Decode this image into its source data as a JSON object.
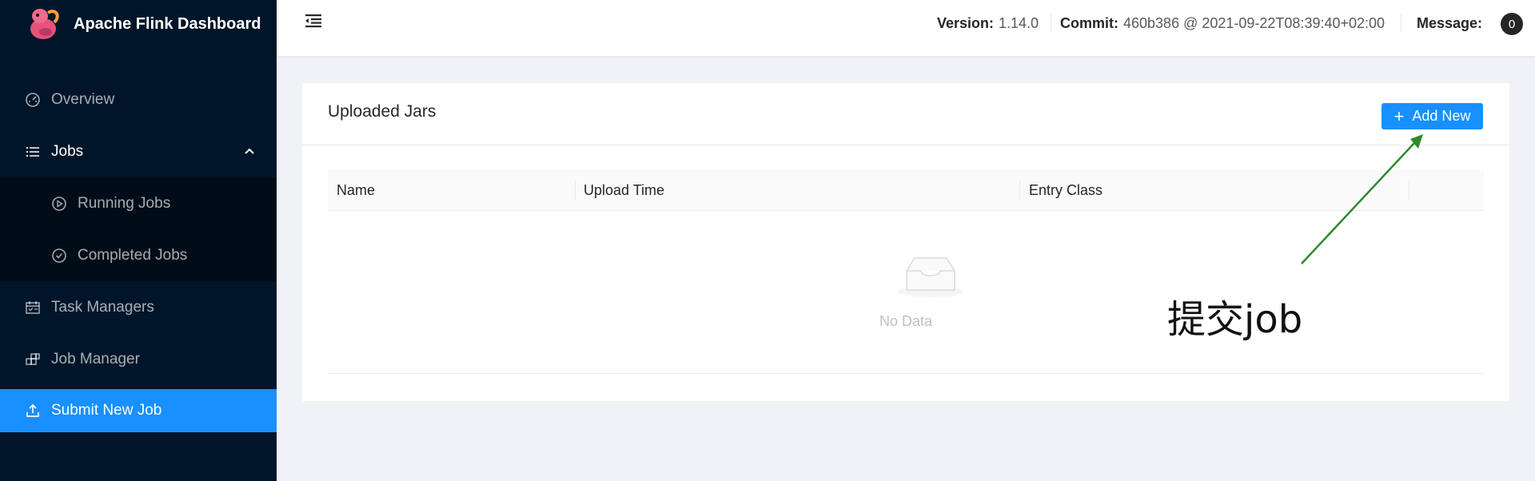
{
  "brand": {
    "title": "Apache Flink Dashboard",
    "logo_icon": "flink-squirrel-logo"
  },
  "sidebar": {
    "items": [
      {
        "label": "Overview",
        "icon": "dashboard-icon"
      },
      {
        "label": "Jobs",
        "icon": "list-icon"
      },
      {
        "label": "Running Jobs",
        "icon": "play-circle-icon"
      },
      {
        "label": "Completed Jobs",
        "icon": "check-circle-icon"
      },
      {
        "label": "Task Managers",
        "icon": "schedule-icon"
      },
      {
        "label": "Job Manager",
        "icon": "build-icon"
      },
      {
        "label": "Submit New Job",
        "icon": "upload-icon"
      }
    ]
  },
  "header": {
    "version_label": "Version:",
    "version_value": "1.14.0",
    "commit_label": "Commit:",
    "commit_value": "460b386 @ 2021-09-22T08:39:40+02:00",
    "message_label": "Message:",
    "message_count": "0"
  },
  "card": {
    "title": "Uploaded Jars",
    "add_button": "Add New",
    "columns": [
      "Name",
      "Upload Time",
      "Entry Class"
    ],
    "empty_text": "No Data"
  },
  "annotation": {
    "text": "提交job",
    "color": "#2e8b2e"
  },
  "colors": {
    "sidebar_bg": "#001529",
    "accent": "#1890ff",
    "submenu_bg": "#000c17"
  }
}
